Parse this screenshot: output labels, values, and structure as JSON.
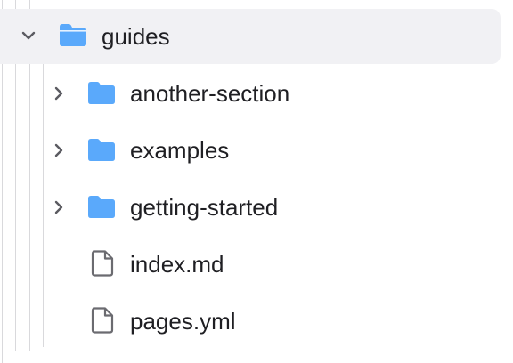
{
  "tree": {
    "root": {
      "label": "guides",
      "icon": "folder-open-icon",
      "expanded": true,
      "selected": true
    },
    "children": [
      {
        "label": "another-section",
        "type": "folder",
        "icon": "folder-icon",
        "expanded": false
      },
      {
        "label": "examples",
        "type": "folder",
        "icon": "folder-icon",
        "expanded": false
      },
      {
        "label": "getting-started",
        "type": "folder",
        "icon": "folder-icon",
        "expanded": false
      },
      {
        "label": "index.md",
        "type": "file",
        "icon": "file-icon"
      },
      {
        "label": "pages.yml",
        "type": "file",
        "icon": "file-icon"
      }
    ]
  },
  "colors": {
    "folder": "#5aa9fb",
    "selected_bg": "#f1f1f4",
    "text": "#1f1f23",
    "chevron": "#5b5b61",
    "file_stroke": "#6b6b70",
    "guide_line": "#d9d9dc"
  }
}
